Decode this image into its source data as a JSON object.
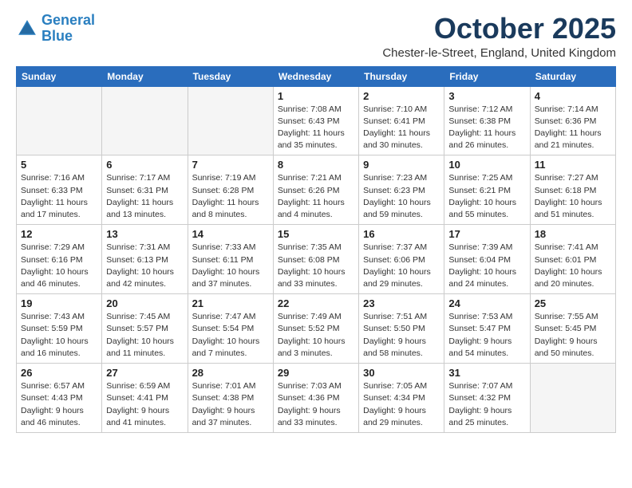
{
  "header": {
    "logo_line1": "General",
    "logo_line2": "Blue",
    "month": "October 2025",
    "location": "Chester-le-Street, England, United Kingdom"
  },
  "days_of_week": [
    "Sunday",
    "Monday",
    "Tuesday",
    "Wednesday",
    "Thursday",
    "Friday",
    "Saturday"
  ],
  "weeks": [
    [
      {
        "day": "",
        "info": ""
      },
      {
        "day": "",
        "info": ""
      },
      {
        "day": "",
        "info": ""
      },
      {
        "day": "1",
        "info": "Sunrise: 7:08 AM\nSunset: 6:43 PM\nDaylight: 11 hours\nand 35 minutes."
      },
      {
        "day": "2",
        "info": "Sunrise: 7:10 AM\nSunset: 6:41 PM\nDaylight: 11 hours\nand 30 minutes."
      },
      {
        "day": "3",
        "info": "Sunrise: 7:12 AM\nSunset: 6:38 PM\nDaylight: 11 hours\nand 26 minutes."
      },
      {
        "day": "4",
        "info": "Sunrise: 7:14 AM\nSunset: 6:36 PM\nDaylight: 11 hours\nand 21 minutes."
      }
    ],
    [
      {
        "day": "5",
        "info": "Sunrise: 7:16 AM\nSunset: 6:33 PM\nDaylight: 11 hours\nand 17 minutes."
      },
      {
        "day": "6",
        "info": "Sunrise: 7:17 AM\nSunset: 6:31 PM\nDaylight: 11 hours\nand 13 minutes."
      },
      {
        "day": "7",
        "info": "Sunrise: 7:19 AM\nSunset: 6:28 PM\nDaylight: 11 hours\nand 8 minutes."
      },
      {
        "day": "8",
        "info": "Sunrise: 7:21 AM\nSunset: 6:26 PM\nDaylight: 11 hours\nand 4 minutes."
      },
      {
        "day": "9",
        "info": "Sunrise: 7:23 AM\nSunset: 6:23 PM\nDaylight: 10 hours\nand 59 minutes."
      },
      {
        "day": "10",
        "info": "Sunrise: 7:25 AM\nSunset: 6:21 PM\nDaylight: 10 hours\nand 55 minutes."
      },
      {
        "day": "11",
        "info": "Sunrise: 7:27 AM\nSunset: 6:18 PM\nDaylight: 10 hours\nand 51 minutes."
      }
    ],
    [
      {
        "day": "12",
        "info": "Sunrise: 7:29 AM\nSunset: 6:16 PM\nDaylight: 10 hours\nand 46 minutes."
      },
      {
        "day": "13",
        "info": "Sunrise: 7:31 AM\nSunset: 6:13 PM\nDaylight: 10 hours\nand 42 minutes."
      },
      {
        "day": "14",
        "info": "Sunrise: 7:33 AM\nSunset: 6:11 PM\nDaylight: 10 hours\nand 37 minutes."
      },
      {
        "day": "15",
        "info": "Sunrise: 7:35 AM\nSunset: 6:08 PM\nDaylight: 10 hours\nand 33 minutes."
      },
      {
        "day": "16",
        "info": "Sunrise: 7:37 AM\nSunset: 6:06 PM\nDaylight: 10 hours\nand 29 minutes."
      },
      {
        "day": "17",
        "info": "Sunrise: 7:39 AM\nSunset: 6:04 PM\nDaylight: 10 hours\nand 24 minutes."
      },
      {
        "day": "18",
        "info": "Sunrise: 7:41 AM\nSunset: 6:01 PM\nDaylight: 10 hours\nand 20 minutes."
      }
    ],
    [
      {
        "day": "19",
        "info": "Sunrise: 7:43 AM\nSunset: 5:59 PM\nDaylight: 10 hours\nand 16 minutes."
      },
      {
        "day": "20",
        "info": "Sunrise: 7:45 AM\nSunset: 5:57 PM\nDaylight: 10 hours\nand 11 minutes."
      },
      {
        "day": "21",
        "info": "Sunrise: 7:47 AM\nSunset: 5:54 PM\nDaylight: 10 hours\nand 7 minutes."
      },
      {
        "day": "22",
        "info": "Sunrise: 7:49 AM\nSunset: 5:52 PM\nDaylight: 10 hours\nand 3 minutes."
      },
      {
        "day": "23",
        "info": "Sunrise: 7:51 AM\nSunset: 5:50 PM\nDaylight: 9 hours\nand 58 minutes."
      },
      {
        "day": "24",
        "info": "Sunrise: 7:53 AM\nSunset: 5:47 PM\nDaylight: 9 hours\nand 54 minutes."
      },
      {
        "day": "25",
        "info": "Sunrise: 7:55 AM\nSunset: 5:45 PM\nDaylight: 9 hours\nand 50 minutes."
      }
    ],
    [
      {
        "day": "26",
        "info": "Sunrise: 6:57 AM\nSunset: 4:43 PM\nDaylight: 9 hours\nand 46 minutes."
      },
      {
        "day": "27",
        "info": "Sunrise: 6:59 AM\nSunset: 4:41 PM\nDaylight: 9 hours\nand 41 minutes."
      },
      {
        "day": "28",
        "info": "Sunrise: 7:01 AM\nSunset: 4:38 PM\nDaylight: 9 hours\nand 37 minutes."
      },
      {
        "day": "29",
        "info": "Sunrise: 7:03 AM\nSunset: 4:36 PM\nDaylight: 9 hours\nand 33 minutes."
      },
      {
        "day": "30",
        "info": "Sunrise: 7:05 AM\nSunset: 4:34 PM\nDaylight: 9 hours\nand 29 minutes."
      },
      {
        "day": "31",
        "info": "Sunrise: 7:07 AM\nSunset: 4:32 PM\nDaylight: 9 hours\nand 25 minutes."
      },
      {
        "day": "",
        "info": ""
      }
    ]
  ]
}
